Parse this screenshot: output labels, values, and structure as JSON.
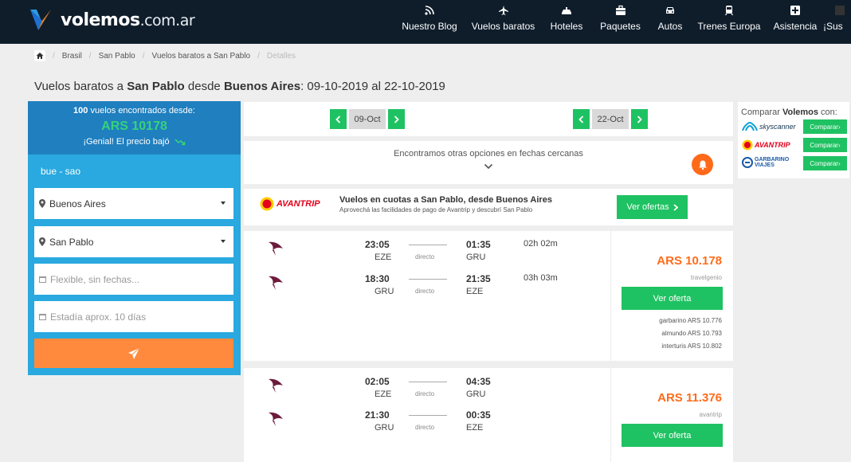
{
  "brand": {
    "name": "volemos",
    "domain": ".com.ar"
  },
  "nav": [
    {
      "label": "Nuestro Blog",
      "icon": "rss-icon"
    },
    {
      "label": "Vuelos baratos",
      "icon": "airplane-icon"
    },
    {
      "label": "Hoteles",
      "icon": "hotel-icon"
    },
    {
      "label": "Paquetes",
      "icon": "suitcase-icon"
    },
    {
      "label": "Autos",
      "icon": "car-icon"
    },
    {
      "label": "Trenes Europa",
      "icon": "train-icon"
    },
    {
      "label": "Asistencia",
      "icon": "medical-cross-icon"
    },
    {
      "label": "¡Sus",
      "icon": "generic-icon"
    }
  ],
  "breadcrumb": [
    "Brasil",
    "San Pablo",
    "Vuelos baratos a San Pablo",
    "Detalles"
  ],
  "title": {
    "p1": "Vuelos baratos a ",
    "dest": "San Pablo",
    "p2": " desde ",
    "orig": "Buenos Aires",
    "p3": ": 09-10-2019 al 22-10-2019"
  },
  "summary": {
    "count": "100",
    "count_suffix": " vuelos encontrados desde:",
    "price": "ARS 10178",
    "message": "¡Genial! El precio bajó"
  },
  "search": {
    "route": "bue - sao",
    "origin": "Buenos Aires",
    "destination": "San Pablo",
    "dates_placeholder": "Flexible, sin fechas...",
    "stay_placeholder": "Estadía aprox. 10 días"
  },
  "dates": {
    "outbound": "09-Oct",
    "return": "22-Oct"
  },
  "nearby": {
    "text": "Encontramos otras opciones en fechas cercanas"
  },
  "promo": {
    "brand": "AVANTRIP",
    "title": "Vuelos en cuotas a San Pablo, desde Buenos Aires",
    "subtitle": "Aprovechá las facilidades de pago de Avantrip y descubrí San Pablo",
    "button": "Ver ofertas"
  },
  "results": [
    {
      "segments": [
        {
          "dep_time": "23:05",
          "dep_airport": "EZE",
          "stops": "directo",
          "arr_time": "01:35",
          "arr_airport": "GRU",
          "duration": "02h 02m"
        },
        {
          "dep_time": "18:30",
          "dep_airport": "GRU",
          "stops": "directo",
          "arr_time": "21:35",
          "arr_airport": "EZE",
          "duration": "03h 03m"
        }
      ],
      "price": "ARS 10.178",
      "source": "travelgenio",
      "button": "Ver oferta",
      "alternatives": [
        "garbarino ARS 10.776",
        "almundo ARS 10.793",
        "interturis ARS 10.802"
      ]
    },
    {
      "segments": [
        {
          "dep_time": "02:05",
          "dep_airport": "EZE",
          "stops": "directo",
          "arr_time": "04:35",
          "arr_airport": "GRU",
          "duration": ""
        },
        {
          "dep_time": "21:30",
          "dep_airport": "GRU",
          "stops": "directo",
          "arr_time": "00:35",
          "arr_airport": "EZE",
          "duration": ""
        }
      ],
      "price": "ARS 11.376",
      "source": "avantrip",
      "button": "Ver oferta",
      "alternatives": []
    }
  ],
  "compare": {
    "prefix": "Comparar ",
    "brand": "Volemos",
    "suffix": " con:",
    "items": [
      {
        "name": "skyscanner",
        "button": "Comparar"
      },
      {
        "name": "AVANTRIP",
        "button": "Comparar"
      },
      {
        "name": "GARBARINO VIAJES",
        "button": "Comparar"
      }
    ]
  },
  "colors": {
    "header": "#0f1d2b",
    "accent_green": "#1fc262",
    "price_orange": "#ff6b1a",
    "panel_blue": "#29a9df",
    "panel_dark_blue": "#1f7fbf"
  }
}
